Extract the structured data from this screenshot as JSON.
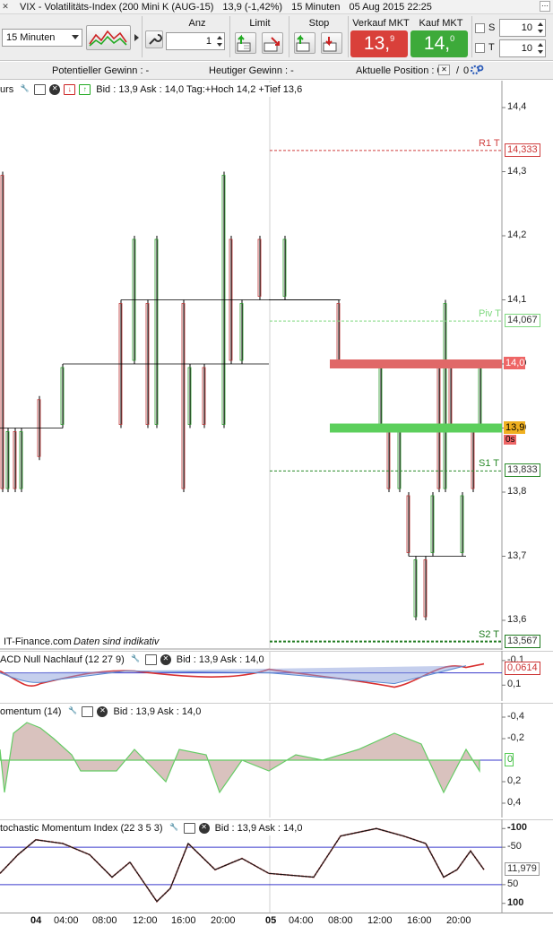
{
  "titlebar": {
    "close_glyph": "✕",
    "instrument": "VIX - Volatilitäts-Index (200 Mini K (AUG-15)",
    "price_change": "13,9 (-1,42%)",
    "timeframe": "15 Minuten",
    "datetime": "05 Aug 2015 22:25"
  },
  "toolbar": {
    "timeframe_select": "15 Minuten",
    "anz_label": "Anz",
    "anz_value": "1",
    "limit_label": "Limit",
    "stop_label": "Stop",
    "sell_label": "Verkauf MKT",
    "buy_label": "Kauf MKT",
    "sell_price_main": "13,",
    "sell_price_sup": "9",
    "buy_price_main": "14,",
    "buy_price_sup": "0",
    "s_label": "S",
    "t_label": "T",
    "s_value": "10",
    "t_value": "10",
    "sell_color": "#d9403a",
    "buy_color": "#3daa3a"
  },
  "infobar": {
    "potential_gain": "Potentieller Gewinn : -",
    "daily_gain": "Heutiger Gewinn : -",
    "position_label": "Aktuelle Position : 0",
    "position_sep": "/",
    "position_value": "0"
  },
  "main_pane": {
    "header_name": "urs",
    "header_text": "Bid : 13,9 Ask : 14,0 Tag:+Hoch 14,2 +Tief 13,6",
    "footer_source": "IT-Finance.com",
    "footer_note": "Daten sind indikativ",
    "y_ticks": [
      "14,4",
      "14,3",
      "14,2",
      "14,1",
      "14,0",
      "13,9",
      "13,8",
      "13,7",
      "13,6"
    ],
    "levels": [
      {
        "name": "R1 T",
        "value": "14,333",
        "color": "#d04040"
      },
      {
        "name": "Piv T",
        "value": "14,067",
        "color": "#7ed87e"
      },
      {
        "name": "S1 T",
        "value": "13,833",
        "color": "#2a8a2a"
      },
      {
        "name": "S2 T",
        "value": "13,567",
        "color": "#1f7a1f"
      }
    ],
    "ask_tag": "14,0",
    "bid_tag": "13,9",
    "countdown": "0s"
  },
  "macd_pane": {
    "header_name": "ACD Null Nachlauf (12 27 9)",
    "header_text": "Bid : 13,9 Ask : 14,0",
    "y_ticks": [
      "0,1",
      "-0,1"
    ],
    "value_tag": "0,0614"
  },
  "momentum_pane": {
    "header_name": "omentum (14)",
    "header_text": "Bid : 13,9 Ask : 14,0",
    "y_ticks": [
      "0,4",
      "0,2",
      "-0,2",
      "-0,4"
    ],
    "value_tag": "0"
  },
  "stoch_pane": {
    "header_name": "tochastic Momentum Index (22 3 5 3)",
    "header_text": "Bid : 13,9 Ask : 14,0",
    "y_ticks": [
      "100",
      "50",
      "-50",
      "-100"
    ],
    "value_tag": "11,979"
  },
  "xaxis": {
    "labels": [
      "04",
      "04:00",
      "08:00",
      "12:00",
      "16:00",
      "20:00",
      "05",
      "04:00",
      "08:00",
      "12:00",
      "16:00",
      "20:00"
    ]
  }
}
